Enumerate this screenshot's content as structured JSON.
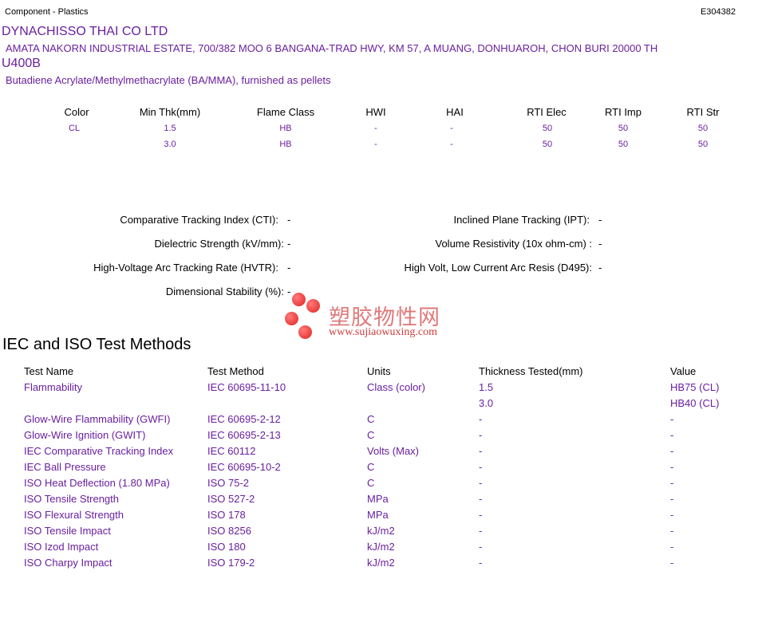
{
  "header": {
    "category": "Component - Plastics",
    "file_no": "E304382",
    "company": "DYNACHISSO THAI CO LTD",
    "address": "AMATA NAKORN INDUSTRIAL ESTATE, 700/382 MOO 6 BANGANA-TRAD HWY, KM 57, A MUANG, DONHUAROH, CHON BURI    20000 TH",
    "grade": "U400B",
    "description": "Butadiene Acrylate/Methylmethacrylate (BA/MMA), furnished as pellets"
  },
  "ratings": {
    "columns": [
      "Color",
      "Min Thk(mm)",
      "Flame Class",
      "HWI",
      "HAI",
      "RTI Elec",
      "RTI Imp",
      "RTI Str"
    ],
    "rows": [
      [
        "CL",
        "1.5",
        "HB",
        "-",
        "-",
        "50",
        "50",
        "50"
      ],
      [
        "",
        "3.0",
        "HB",
        "-",
        "-",
        "50",
        "50",
        "50"
      ]
    ]
  },
  "properties": {
    "cti_label": "Comparative Tracking Index (CTI):",
    "cti_value": "-",
    "ipt_label": "Inclined Plane Tracking (IPT):",
    "ipt_value": "-",
    "dielectric_label": "Dielectric Strength (kV/mm):",
    "dielectric_value": "-",
    "volume_label": "Volume Resistivity (10x ohm-cm) :",
    "volume_value": "-",
    "hvtr_label": "High-Voltage Arc Tracking Rate (HVTR):",
    "hvtr_value": "-",
    "d495_label": "High Volt, Low Current Arc Resis (D495):",
    "d495_value": "-",
    "dimensional_label": "Dimensional Stability (%):",
    "dimensional_value": "-"
  },
  "watermark": {
    "chinese": "塑胶物性网",
    "url": "www.sujiaowuxing.com"
  },
  "iec_section": {
    "title": "IEC and ISO Test Methods",
    "columns": [
      "Test Name",
      "Test Method",
      "Units",
      "Thickness Tested(mm)",
      "Value"
    ],
    "rows": [
      [
        "Flammability",
        "IEC 60695-11-10",
        "Class (color)",
        "1.5",
        "HB75 (CL)"
      ],
      [
        "",
        "",
        "",
        "3.0",
        "HB40 (CL)"
      ],
      [
        "Glow-Wire Flammability (GWFI)",
        "IEC 60695-2-12",
        "C",
        "-",
        "-"
      ],
      [
        "Glow-Wire Ignition (GWIT)",
        "IEC 60695-2-13",
        "C",
        "-",
        "-"
      ],
      [
        "IEC Comparative Tracking Index",
        "IEC 60112",
        "Volts (Max)",
        "-",
        "-"
      ],
      [
        "IEC Ball Pressure",
        "IEC 60695-10-2",
        "C",
        "-",
        "-"
      ],
      [
        "ISO Heat Deflection (1.80 MPa)",
        "ISO 75-2",
        "C",
        "-",
        "-"
      ],
      [
        "ISO Tensile Strength",
        "ISO 527-2",
        "MPa",
        "-",
        "-"
      ],
      [
        "ISO Flexural Strength",
        "ISO 178",
        "MPa",
        "-",
        "-"
      ],
      [
        "ISO Tensile Impact",
        "ISO 8256",
        "kJ/m2",
        "-",
        "-"
      ],
      [
        "ISO Izod Impact",
        "ISO 180",
        "kJ/m2",
        "-",
        "-"
      ],
      [
        "ISO Charpy Impact",
        "ISO 179-2",
        "kJ/m2",
        "-",
        "-"
      ]
    ]
  },
  "colors": {
    "accent": "#6a1fa0",
    "watermark_red": "#e32020"
  }
}
